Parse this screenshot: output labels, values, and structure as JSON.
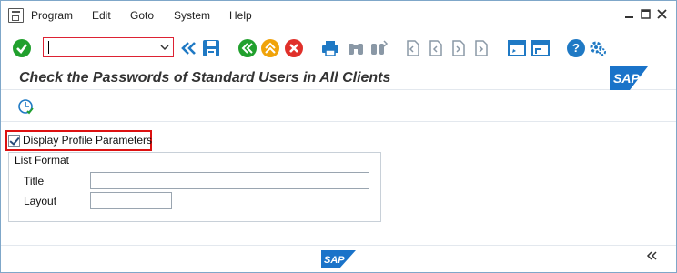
{
  "menu": {
    "items": [
      "Program",
      "Edit",
      "Goto",
      "System",
      "Help"
    ]
  },
  "window_controls": {
    "minimize": "minimize-icon",
    "restore": "restore-icon",
    "close": "close-icon"
  },
  "toolbar": {
    "command_field_value": "",
    "icons": [
      "enter-icon",
      "back-all-icon",
      "save-icon",
      "back-icon",
      "exit-icon",
      "cancel-icon",
      "print-icon",
      "find-icon",
      "find-next-icon",
      "first-page-icon",
      "previous-page-icon",
      "next-page-icon",
      "last-page-icon",
      "create-session-icon",
      "create-shortcut-icon",
      "help-icon",
      "customize-layout-icon"
    ]
  },
  "title": {
    "text": "Check the Passwords of Standard Users in All Clients"
  },
  "logo": {
    "text": "SAP"
  },
  "app_toolbar": {
    "execute_icon": "execute-clock-icon"
  },
  "form": {
    "checkbox_label": "Display Profile Parameters",
    "checkbox_checked": true,
    "group_title": "List Format",
    "title_label": "Title",
    "title_value": "",
    "layout_label": "Layout",
    "layout_value": ""
  },
  "footer": {
    "logo_text": "SAP",
    "collapse_icon": "double-chevron-left-icon"
  },
  "colors": {
    "green": "#21a02d",
    "orange": "#f0a30a",
    "red": "#e0302a",
    "blue": "#1f79c4",
    "highlight": "#dd1111"
  }
}
